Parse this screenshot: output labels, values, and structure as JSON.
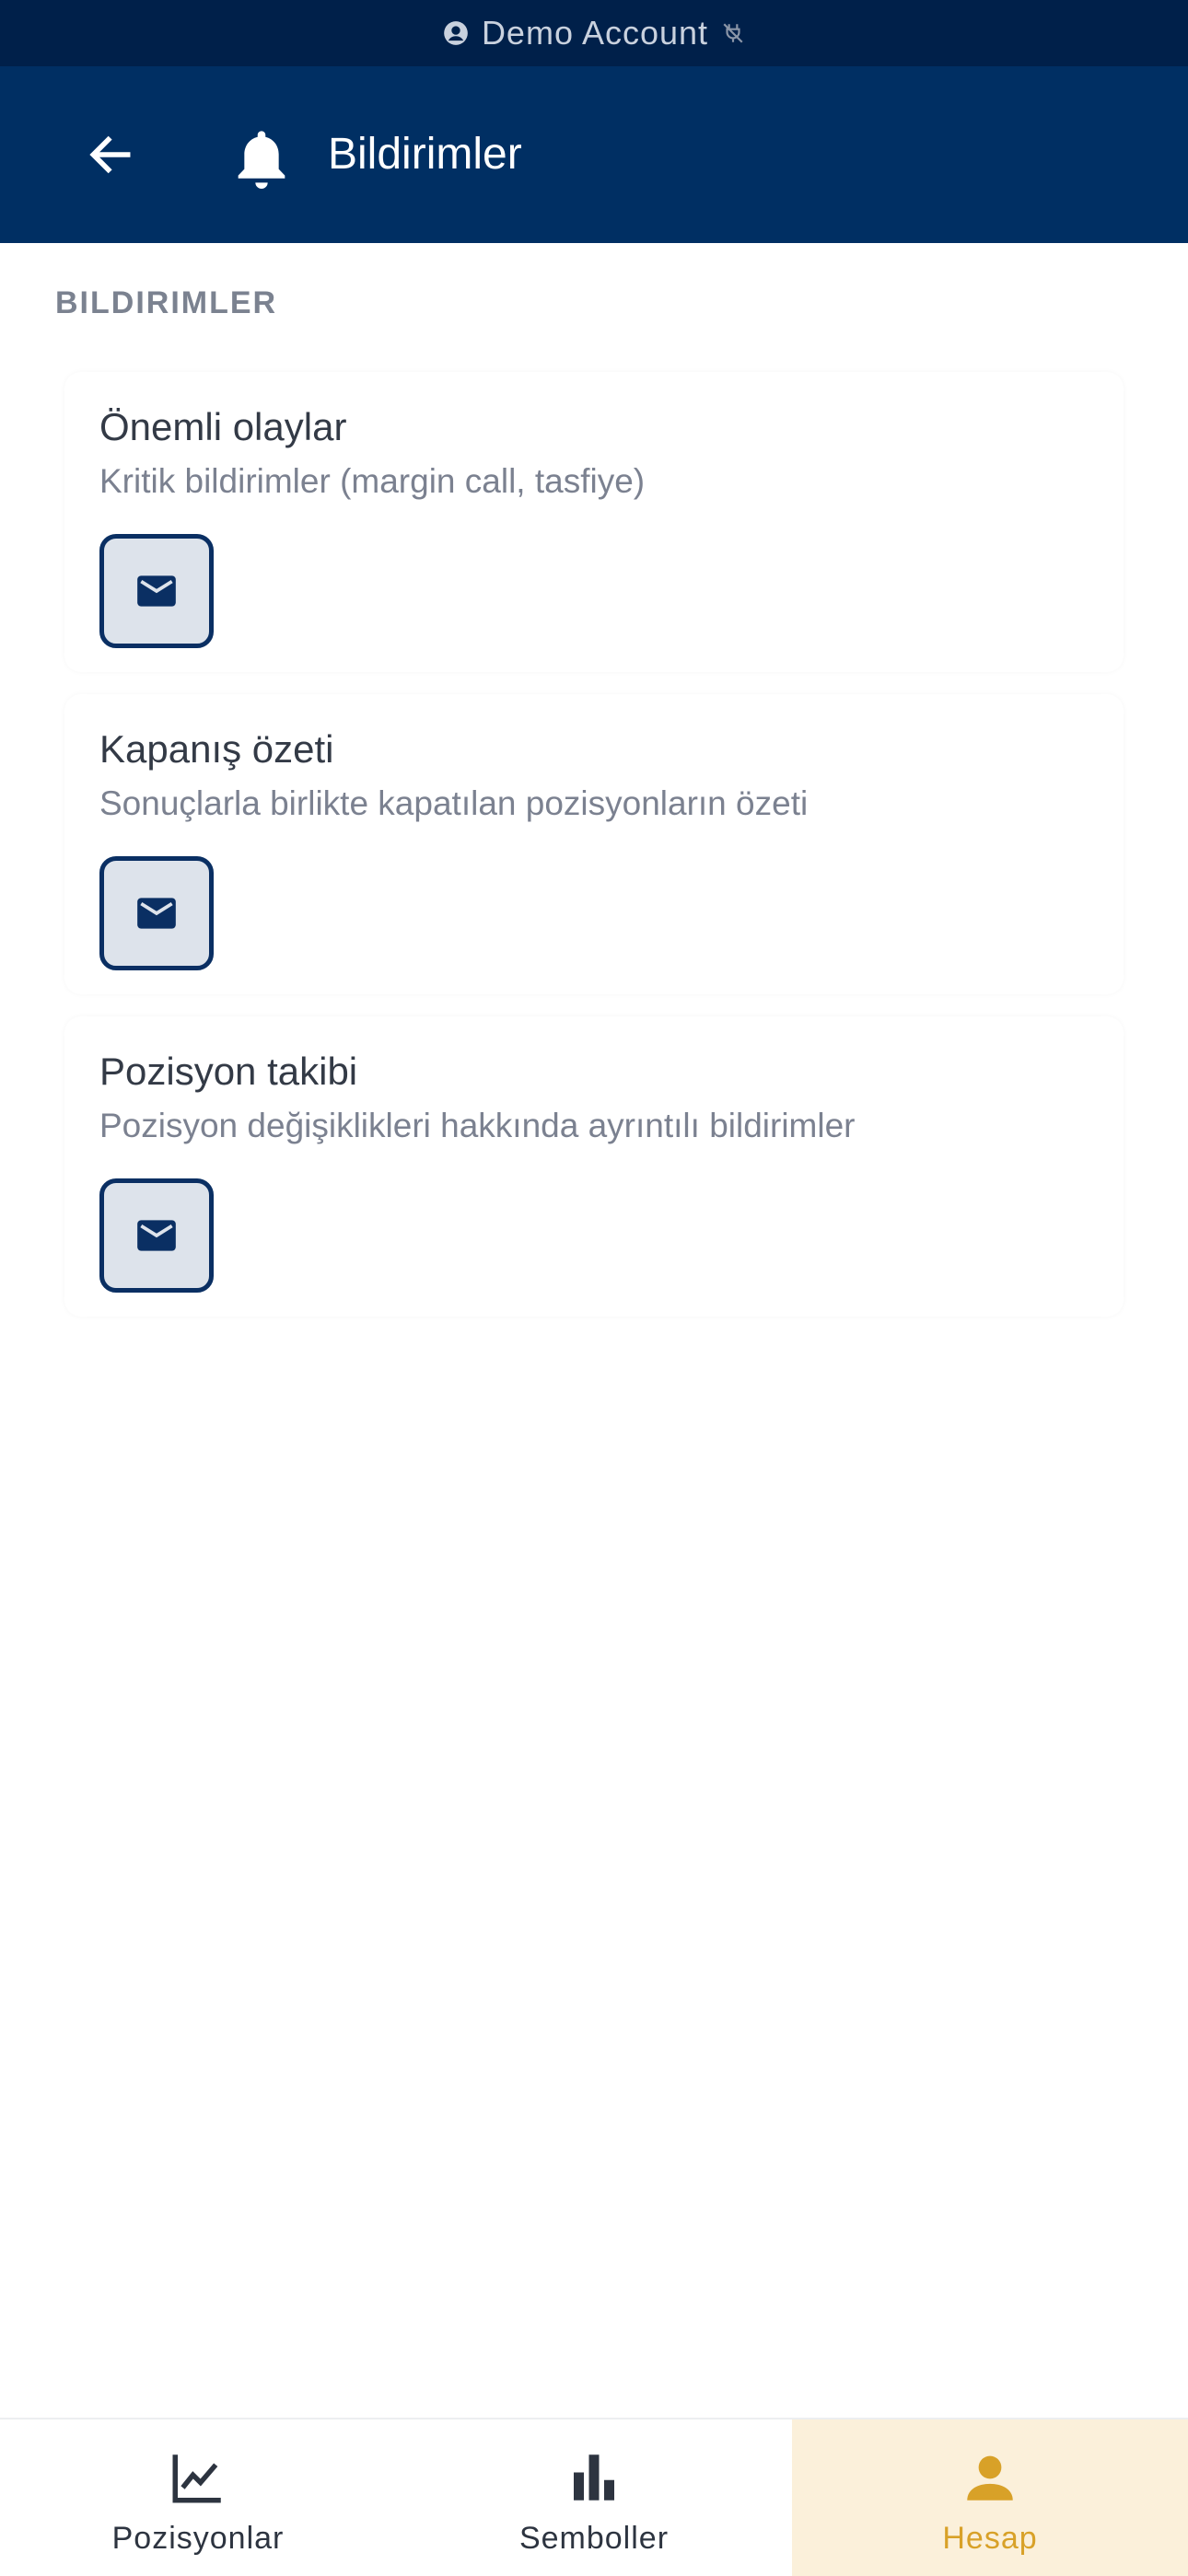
{
  "status": {
    "account_label": "Demo Account",
    "account_icon": "account-circle-icon",
    "connection_icon": "connection-off-icon"
  },
  "header": {
    "title": "Bildirimler",
    "back_icon": "arrow-left-icon",
    "title_icon": "bell-icon"
  },
  "section": {
    "title": "BILDIRIMLER"
  },
  "cards": [
    {
      "title": "Önemli olaylar",
      "description": "Kritik bildirimler (margin call, tasfiye)",
      "channel_icon": "mail-icon"
    },
    {
      "title": "Kapanış özeti",
      "description": "Sonuçlarla birlikte kapatılan pozisyonların özeti",
      "channel_icon": "mail-icon"
    },
    {
      "title": "Pozisyon takibi",
      "description": "Pozisyon değişiklikleri hakkında ayrıntılı bildirimler",
      "channel_icon": "mail-icon"
    }
  ],
  "nav": [
    {
      "label": "Pozisyonlar",
      "icon": "line-chart-icon",
      "active": false
    },
    {
      "label": "Semboller",
      "icon": "bar-chart-icon",
      "active": false
    },
    {
      "label": "Hesap",
      "icon": "person-icon",
      "active": true
    }
  ],
  "colors": {
    "primary": "#002f63",
    "status_bar": "#00204a",
    "accent": "#d8a128",
    "active_tab_bg": "#fbf0da"
  }
}
